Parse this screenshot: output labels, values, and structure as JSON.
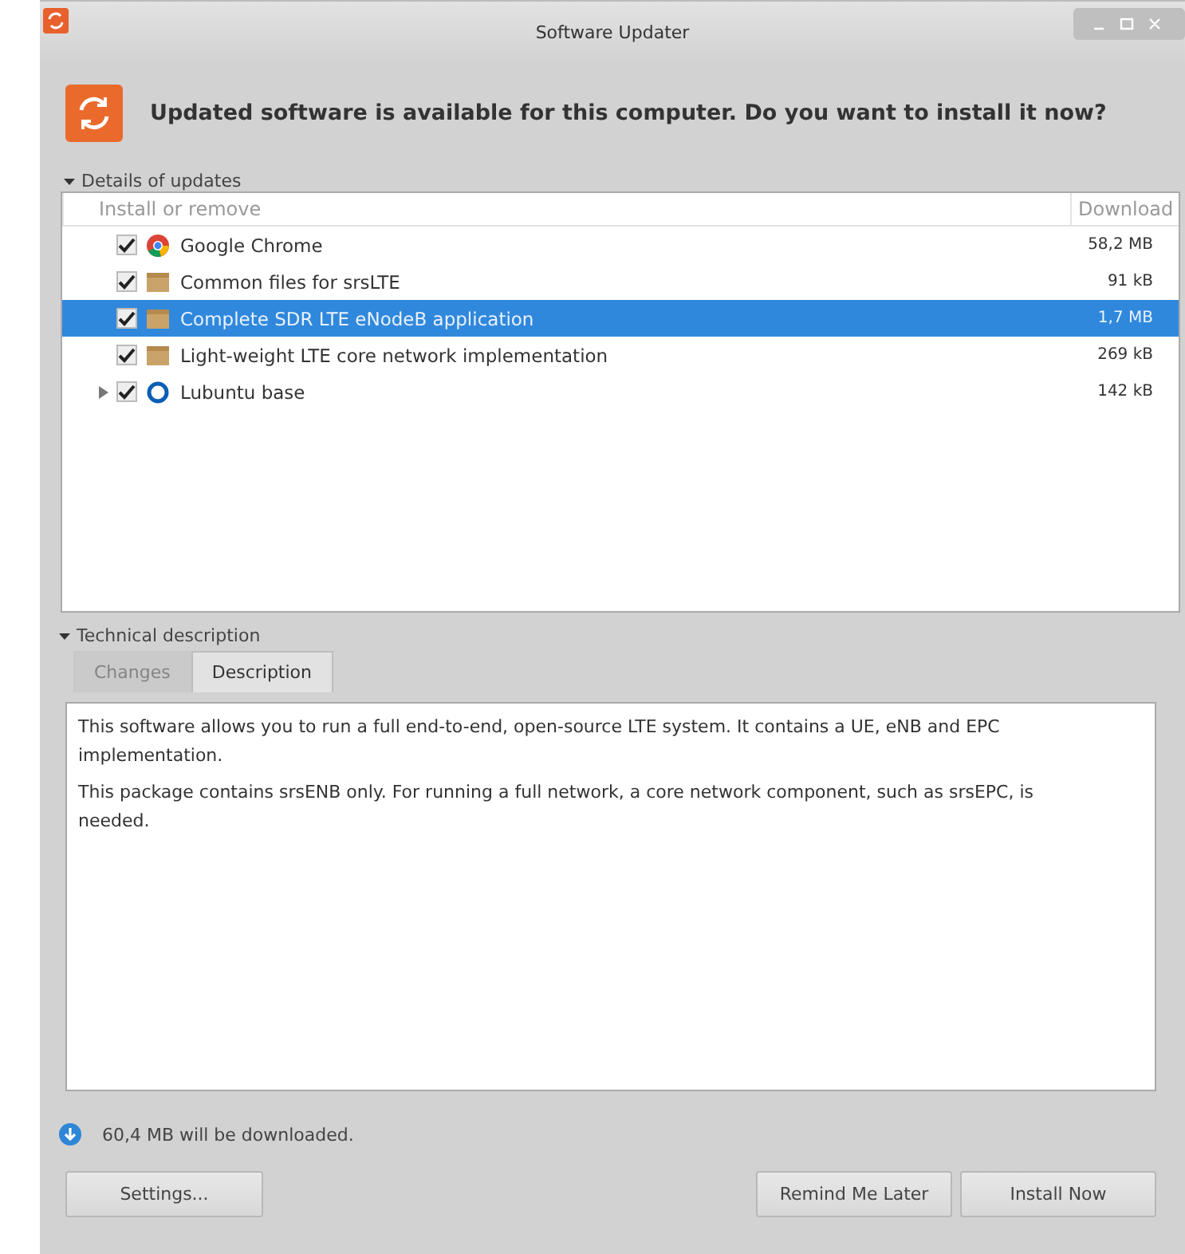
{
  "window": {
    "title": "Software Updater"
  },
  "header": "Updated software is available for this computer. Do you want to install it now?",
  "details": {
    "label": "Details of updates",
    "expanded": true,
    "columns": [
      "Install or remove",
      "Download"
    ],
    "rows": [
      {
        "name": "Google Chrome",
        "size": "58,2 MB",
        "checked": true,
        "selected": false,
        "kind": "browser"
      },
      {
        "name": "Common files for srsLTE",
        "size": "91 kB",
        "checked": true,
        "selected": false,
        "kind": "package"
      },
      {
        "name": "Complete SDR LTE eNodeB application",
        "size": "1,7 MB",
        "checked": true,
        "selected": true,
        "kind": "package"
      },
      {
        "name": "Light-weight LTE core network implementation",
        "size": "269 kB",
        "checked": true,
        "selected": false,
        "kind": "package"
      },
      {
        "name": "Lubuntu base",
        "size": "142 kB",
        "checked": true,
        "selected": false,
        "kind": "group",
        "expanded": false
      }
    ]
  },
  "technical": {
    "label": "Technical description",
    "expanded": true,
    "tabs": [
      {
        "label": "Changes",
        "selected": false,
        "disabled": true
      },
      {
        "label": "Description",
        "selected": true,
        "disabled": false
      }
    ],
    "paragraphs": [
      "This software allows you to run a full end-to-end, open-source LTE system. It contains a UE, eNB and EPC implementation.",
      "This package contains srsENB only. For running a full network, a core network component, such as srsEPC, is needed."
    ]
  },
  "download_info": "60,4 MB will be downloaded.",
  "buttons": {
    "left": [
      "Settings..."
    ],
    "right": [
      "Remind Me Later",
      "Install Now"
    ]
  }
}
